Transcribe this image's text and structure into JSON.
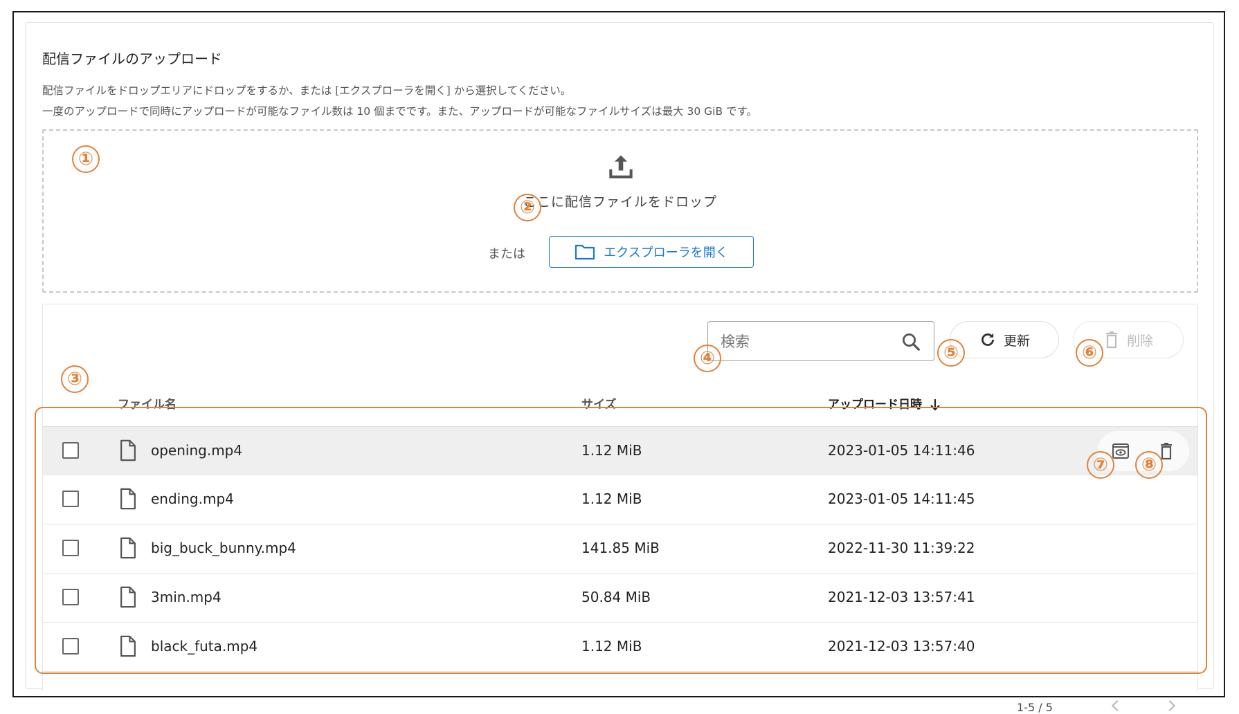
{
  "upload": {
    "title": "配信ファイルのアップロード",
    "description_1": "配信ファイルをドロップエリアにドロップをするか、または [エクスプローラを開く] から選択してください。",
    "description_2": "一度のアップロードで同時にアップロードが可能なファイル数は 10 個までです。また、アップロードが可能なファイルサイズは最大 30 GiB です。",
    "drop_text": "ここに配信ファイルをドロップ",
    "or_text": "または",
    "explorer_button": "エクスプローラを開く"
  },
  "toolbar": {
    "search_placeholder": "検索",
    "refresh_label": "更新",
    "delete_label": "削除"
  },
  "table": {
    "columns": [
      "ファイル名",
      "サイズ",
      "アップロード日時"
    ],
    "rows": [
      {
        "name": "opening.mp4",
        "size": "1.12 MiB",
        "date": "2023-01-05 14:11:46"
      },
      {
        "name": "ending.mp4",
        "size": "1.12 MiB",
        "date": "2023-01-05 14:11:45"
      },
      {
        "name": "big_buck_bunny.mp4",
        "size": "141.85 MiB",
        "date": "2022-11-30 11:39:22"
      },
      {
        "name": "3min.mp4",
        "size": "50.84 MiB",
        "date": "2021-12-03 13:57:41"
      },
      {
        "name": "black_futa.mp4",
        "size": "1.12 MiB",
        "date": "2021-12-03 13:57:40"
      }
    ],
    "highlighted_row": 0
  },
  "pagination": {
    "range": "1-5 / 5"
  },
  "annotations": [
    "①",
    "②",
    "③",
    "④",
    "⑤",
    "⑥",
    "⑦",
    "⑧"
  ],
  "colors": {
    "accent": "#1976d2",
    "annotation": "#e0823a",
    "disabled": "#bdbdbd",
    "row_highlight": "#efefef"
  }
}
